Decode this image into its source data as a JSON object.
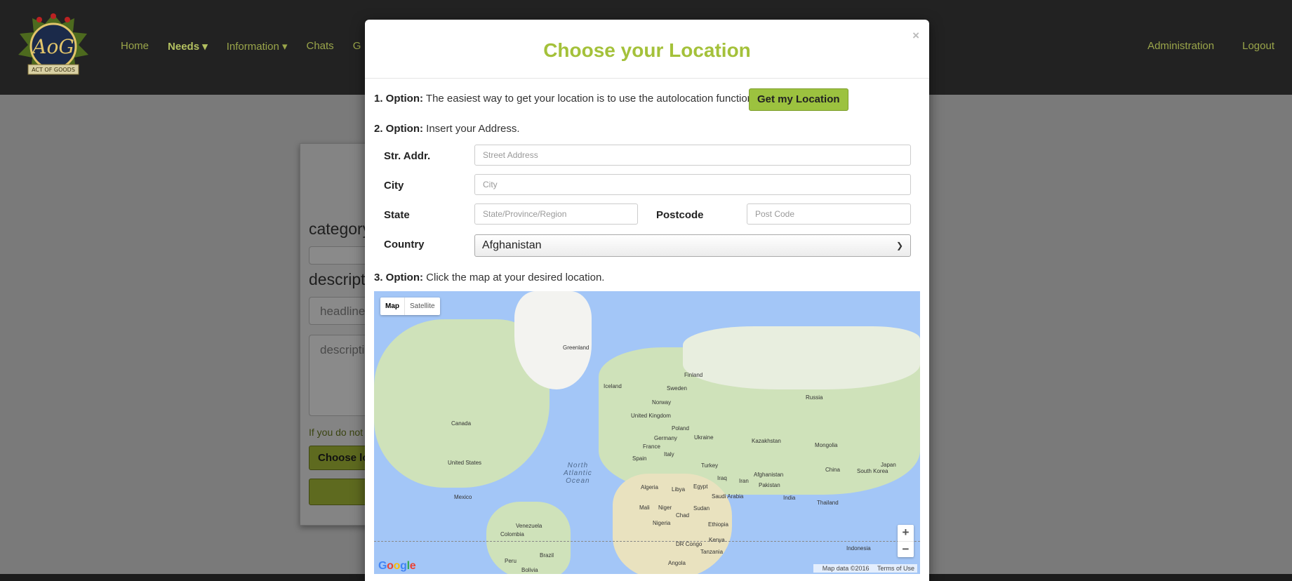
{
  "navbar": {
    "logo_text": "AoG",
    "logo_banner": "ACT OF GOODS",
    "links": [
      "Home",
      "Needs",
      "Information",
      "Chats",
      "G"
    ],
    "right_links": [
      "Administration",
      "Logout"
    ]
  },
  "background_page": {
    "category_label": "category",
    "description_label": "descript",
    "headline_placeholder": "headline",
    "description_placeholder": "descriptic",
    "hint_text": "If you do not",
    "choose_button": "Choose lo"
  },
  "modal": {
    "title": "Choose your Location",
    "close": "×",
    "option1_label": "1. Option:",
    "option1_text": "The easiest way to get your location is to use the autolocation function.",
    "get_location_button": "Get my Location",
    "option2_label": "2. Option:",
    "option2_text": "Insert your Address.",
    "fields": {
      "street_label": "Str. Addr.",
      "street_placeholder": "Street Address",
      "city_label": "City",
      "city_placeholder": "City",
      "state_label": "State",
      "state_placeholder": "State/Province/Region",
      "postcode_label": "Postcode",
      "postcode_placeholder": "Post Code",
      "country_label": "Country",
      "country_value": "Afghanistan"
    },
    "option3_label": "3. Option:",
    "option3_text": "Click the map at your desired location.",
    "map": {
      "type_map": "Map",
      "type_satellite": "Satellite",
      "zoom_in": "+",
      "zoom_out": "−",
      "google": "Google",
      "map_data": "Map data ©2016",
      "terms": "Terms of Use",
      "ocean": "North\nAtlantic\nOcean",
      "labels": [
        "Greenland",
        "Iceland",
        "Finland",
        "Sweden",
        "Norway",
        "Russia",
        "United Kingdom",
        "Poland",
        "Ukraine",
        "Germany",
        "France",
        "Spain",
        "Italy",
        "Turkey",
        "Kazakhstan",
        "Mongolia",
        "China",
        "South Korea",
        "Japan",
        "Canada",
        "United States",
        "Mexico",
        "Algeria",
        "Libya",
        "Egypt",
        "Iraq",
        "Iran",
        "Afghanistan",
        "Pakistan",
        "India",
        "Thailand",
        "Saudi Arabia",
        "Mali",
        "Niger",
        "Chad",
        "Sudan",
        "Nigeria",
        "Ethiopia",
        "DR Congo",
        "Kenya",
        "Tanzania",
        "Angola",
        "Venezuela",
        "Colombia",
        "Brazil",
        "Peru",
        "Bolivia",
        "Indonesia"
      ]
    }
  },
  "colors": {
    "accent_green": "#a4c13a",
    "button_green": "#9cc23f",
    "nav_bg": "#222222"
  }
}
